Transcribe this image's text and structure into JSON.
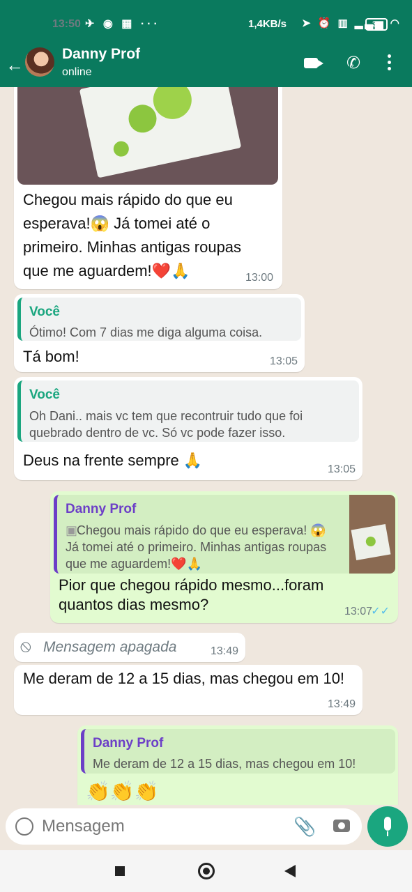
{
  "status_bar": {
    "time": "13:50",
    "speed": "1,4KB/s",
    "battery": "33",
    "left_icons": [
      "telegram-icon",
      "location-icon",
      "app-icon",
      "more-dots-icon"
    ],
    "right_icons": [
      "location-arrow-icon",
      "alarm-icon",
      "volte-icon",
      "signal-icon",
      "wifi-icon"
    ]
  },
  "header": {
    "contact_name": "Danny Prof",
    "status": "online",
    "accent_color": "#0a7a5e"
  },
  "messages": [
    {
      "direction": "incoming",
      "type": "image_with_caption",
      "text": "Chegou mais rápido do que eu esperava!😱 Já tomei até o primeiro. Minhas antigas roupas que me aguardem!❤️🙏",
      "time": "13:00"
    },
    {
      "direction": "incoming",
      "quote": {
        "author": "Você",
        "text": "Ótimo! Com 7 dias me diga alguma coisa."
      },
      "text": "Tá bom!",
      "time": "13:05"
    },
    {
      "direction": "incoming",
      "quote": {
        "author": "Você",
        "text": "Oh Dani.. mais vc tem que recontruir tudo que foi quebrado dentro de vc. Só vc pode fazer isso."
      },
      "text": "Deus na frente sempre 🙏",
      "time": "13:05"
    },
    {
      "direction": "outgoing",
      "quote": {
        "author": "Danny Prof",
        "text": "Chegou mais rápido do que eu esperava! 😱 Já tomei até o primeiro. Minhas antigas roupas que me aguardem!❤️🙏"
      },
      "text": "Pior que chegou rápido mesmo...foram quantos dias mesmo?",
      "time": "13:07",
      "read": true
    },
    {
      "direction": "incoming",
      "deleted": true,
      "text": "Mensagem apagada",
      "time": "13:49"
    },
    {
      "direction": "incoming",
      "text": "Me deram de 12 a 15 dias, mas chegou em 10!",
      "time": "13:49"
    },
    {
      "direction": "outgoing",
      "quote": {
        "author": "Danny Prof",
        "text": "Me deram de 12 a 15 dias, mas chegou em 10!"
      },
      "text": "👏👏👏",
      "time": ""
    }
  ],
  "composer": {
    "placeholder": "Mensagem"
  },
  "ui_text": {
    "back_arrow": "←",
    "phone_glyph": "✆",
    "clip_glyph": "📎",
    "deleted_glyph": "⦸",
    "quote_image_glyph": "▣",
    "read_ticks": "✓✓",
    "status_left_glyphs": "✈ ◉ ▦ ···",
    "status_right_glyphs": "➤ ⏰ ▥ ▂▃▅ ◠"
  },
  "colors": {
    "chat_background": "#efe7de",
    "incoming_bubble": "#ffffff",
    "outgoing_bubble": "#e2fbd0",
    "quote_you": "#1aa67f",
    "quote_contact": "#6c3fc7",
    "read_ticks": "#53bdeb"
  }
}
